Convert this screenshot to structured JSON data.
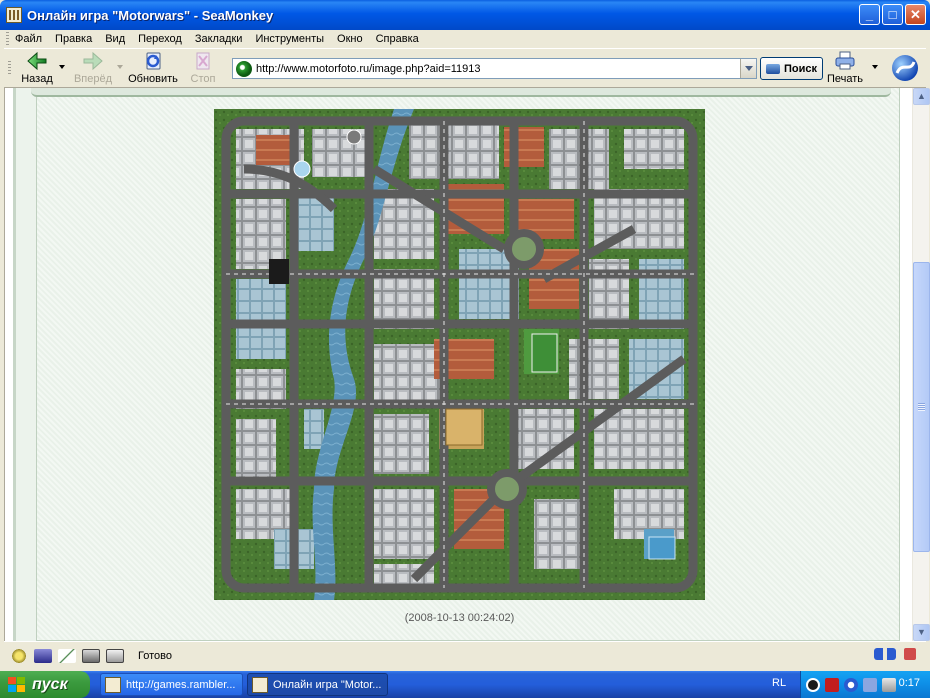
{
  "window": {
    "title": "Онлайн игра \"Motorwars\" - SeaMonkey",
    "minimize": "_",
    "maximize": "□",
    "close": "✕"
  },
  "menu": [
    "Файл",
    "Правка",
    "Вид",
    "Переход",
    "Закладки",
    "Инструменты",
    "Окно",
    "Справка"
  ],
  "toolbar": {
    "back_label": "Назад",
    "forward_label": "Вперёд",
    "reload_label": "Обновить",
    "stop_label": "Стоп",
    "url": "http://www.motorfoto.ru/image.php?aid=11913",
    "search_label": "Поиск",
    "print_label": "Печать"
  },
  "page": {
    "caption": "(2008-10-13 00:24:02)"
  },
  "status": {
    "text": "Готово"
  },
  "taskbar": {
    "start_label": "пуск",
    "tasks": [
      "http://games.rambler...",
      "Онлайн игра \"Motor..."
    ],
    "language": "RL",
    "clock": "0:17"
  },
  "colors": {
    "accent": "#0054E3",
    "grass": "#4a7a33",
    "river": "#5a93b8",
    "road": "#5c5c5c",
    "page_bg": "#eef4ee"
  }
}
